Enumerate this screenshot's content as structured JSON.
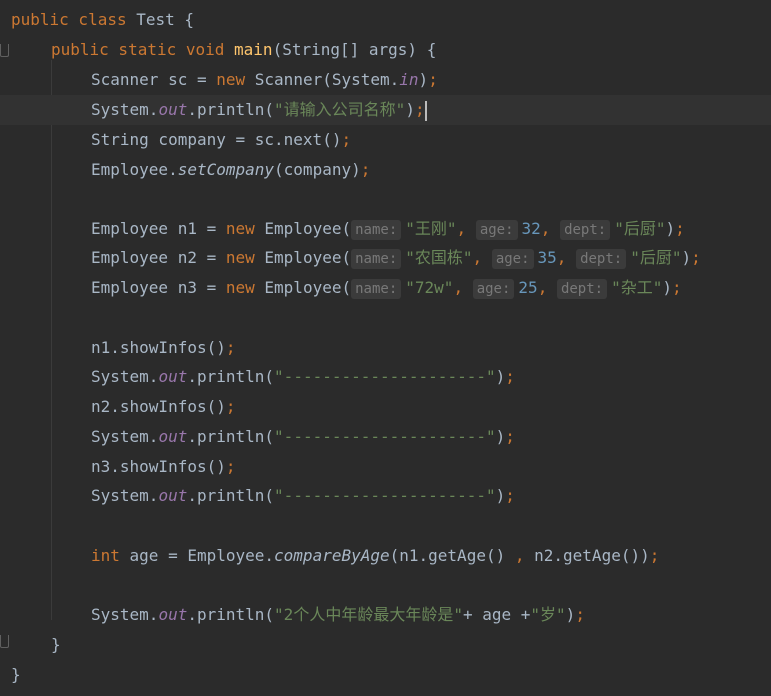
{
  "code": {
    "l1": {
      "kw": "public class",
      "name": "Test",
      "brace": "{"
    },
    "l2": {
      "kw": "public static void",
      "method": "main",
      "params": "(String[] args)",
      "brace": "{"
    },
    "l3": {
      "a": "Scanner sc = ",
      "kw": "new",
      "b": "Scanner(System.",
      "fld": "in",
      "c": ")",
      "semi": ";"
    },
    "l4": {
      "a": "System.",
      "fld": "out",
      "b": ".println(",
      "str": "\"请输入公司名称\"",
      "c": ")",
      "semi": ";"
    },
    "l5": {
      "a": "String company = sc.next()",
      "semi": ";"
    },
    "l6": {
      "a": "Employee.",
      "st": "setCompany",
      "b": "(company)",
      "semi": ";"
    },
    "e1": {
      "a": "Employee n1 = ",
      "kw": "new",
      "b": "Employee(",
      "h1": "name:",
      "s1": "\"王刚\"",
      "h2": "age:",
      "n": "32",
      "h3": "dept:",
      "s2": "\"后厨\"",
      "c": ")",
      "semi": ";"
    },
    "e2": {
      "a": "Employee n2 = ",
      "kw": "new",
      "b": "Employee(",
      "h1": "name:",
      "s1": "\"农国栋\"",
      "h2": "age:",
      "n": "35",
      "h3": "dept:",
      "s2": "\"后厨\"",
      "c": ")",
      "semi": ";"
    },
    "e3": {
      "a": "Employee n3 = ",
      "kw": "new",
      "b": "Employee(",
      "h1": "name:",
      "s1": "\"72w\"",
      "h2": "age:",
      "n": "25",
      "h3": "dept:",
      "s2": "\"杂工\"",
      "c": ")",
      "semi": ";"
    },
    "s1": {
      "a": "n1.showInfos()",
      "semi": ";"
    },
    "p1": {
      "a": "System.",
      "fld": "out",
      "b": ".println(",
      "str": "\"---------------------\"",
      "c": ")",
      "semi": ";"
    },
    "s2": {
      "a": "n2.showInfos()",
      "semi": ";"
    },
    "p2": {
      "a": "System.",
      "fld": "out",
      "b": ".println(",
      "str": "\"---------------------\"",
      "c": ")",
      "semi": ";"
    },
    "s3": {
      "a": "n3.showInfos()",
      "semi": ";"
    },
    "p3": {
      "a": "System.",
      "fld": "out",
      "b": ".println(",
      "str": "\"---------------------\"",
      "c": ")",
      "semi": ";"
    },
    "cmp": {
      "kw": "int",
      "a": " age = Employee.",
      "st": "compareByAge",
      "b": "(n1.getAge() ",
      "comma": ",",
      "c": " n2.getAge())",
      "semi": ";"
    },
    "last": {
      "a": "System.",
      "fld": "out",
      "b": ".println(",
      "str": "\"2个人中年龄最大年龄是\"",
      "c": "+ age +",
      "str2": "\"岁\"",
      "d": ")",
      "semi": ";"
    },
    "close_method": "}",
    "close_class": "}"
  }
}
